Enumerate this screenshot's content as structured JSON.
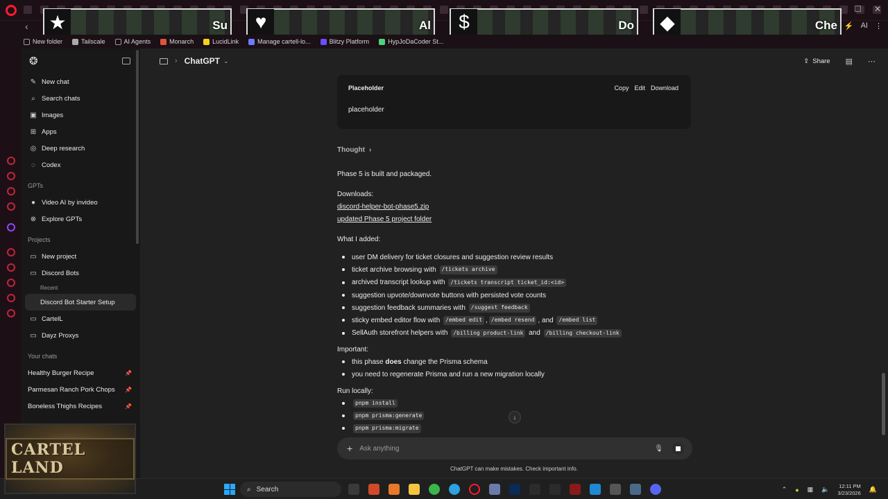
{
  "overlays": [
    {
      "icon": "★",
      "text": "Su"
    },
    {
      "icon": "♥",
      "text": "Al"
    },
    {
      "icon": "$",
      "text": "Do"
    },
    {
      "icon": "◆",
      "text": "Che"
    }
  ],
  "browser": {
    "addr_right": "AI"
  },
  "bookmarks": [
    {
      "label": "New folder",
      "color": "#888888"
    },
    {
      "label": "Tailscale",
      "color": "#aaaaaa"
    },
    {
      "label": "AI Agents",
      "color": "#888888"
    },
    {
      "label": "Monarch",
      "color": "#e0533a"
    },
    {
      "label": "LucidLink",
      "color": "#f2d21b"
    },
    {
      "label": "Manage cartell-lo...",
      "color": "#6b7cff"
    },
    {
      "label": "Blitzy Platform",
      "color": "#6b4cff"
    },
    {
      "label": "HypJoDaCoder St...",
      "color": "#4bd37b"
    }
  ],
  "sidebar": {
    "nav": [
      {
        "label": "New chat",
        "icon": "✎"
      },
      {
        "label": "Search chats",
        "icon": "⌕"
      },
      {
        "label": "Images",
        "icon": "▣"
      },
      {
        "label": "Apps",
        "icon": "⊞"
      },
      {
        "label": "Deep research",
        "icon": "◎"
      },
      {
        "label": "Codex",
        "icon": "◌"
      }
    ],
    "gpts_heading": "GPTs",
    "gpts": [
      {
        "label": "Video AI by invideo",
        "icon": "●"
      },
      {
        "label": "Explore GPTs",
        "icon": "⊗"
      }
    ],
    "projects_heading": "Projects",
    "new_project": "New project",
    "discord_bots": "Discord Bots",
    "recent": "Recent",
    "active_chat": "Discord Bot Starter Setup",
    "cartell": "CartelL",
    "dayz": "Dayz Proxys",
    "your_chats_heading": "Your chats",
    "chats": [
      {
        "label": "Healthy Burger Recipe"
      },
      {
        "label": "Parmesan Ranch Pork Chops"
      },
      {
        "label": "Boneless Thighs Recipes"
      }
    ]
  },
  "webcam": {
    "logo_text": "CARTEL LAND"
  },
  "header": {
    "model": "ChatGPT",
    "share": "Share"
  },
  "doc_card": {
    "title": "Placeholder",
    "copy": "Copy",
    "edit": "Edit",
    "download": "Download",
    "body": "placeholder"
  },
  "message": {
    "thought": "Thought",
    "intro": "Phase 5 is built and packaged.",
    "downloads_label": "Downloads:",
    "link1": "discord-helper-bot-phase5.zip",
    "link2": "updated Phase 5 project folder",
    "added_label": "What I added:",
    "added": {
      "a1": "user DM delivery for ticket closures and suggestion review results",
      "a2_text": "ticket archive browsing with",
      "a2_code": "/tickets archive",
      "a3_text": "archived transcript lookup with",
      "a3_code": "/tickets transcript ticket_id:<id>",
      "a4": "suggestion upvote/downvote buttons with persisted vote counts",
      "a5_text": "suggestion feedback summaries with",
      "a5_code": "/suggest feedback",
      "a6_text": "sticky embed editor flow with",
      "a6_code1": "/embed edit",
      "a6_sep1": ",",
      "a6_code2": "/embed resend",
      "a6_sep2": ", and",
      "a6_code3": "/embed list",
      "a7_text": "SellAuth storefront helpers with",
      "a7_code1": "/billing product-link",
      "a7_sep": "and",
      "a7_code2": "/billing checkout-link"
    },
    "important_label": "Important:",
    "imp1_pre": "this phase",
    "imp1_bold": "does",
    "imp1_post": "change the Prisma schema",
    "imp2": "you need to regenerate Prisma and run a new migration locally",
    "run_label": "Run locally:",
    "run": [
      "pnpm install",
      "pnpm prisma:generate",
      "pnpm prisma:migrate"
    ]
  },
  "composer": {
    "placeholder": "Ask anything",
    "disclaimer": "ChatGPT can make mistakes. Check important info."
  },
  "taskbar": {
    "search": "Search",
    "time": "12:11 PM",
    "date": "3/23/2026"
  }
}
